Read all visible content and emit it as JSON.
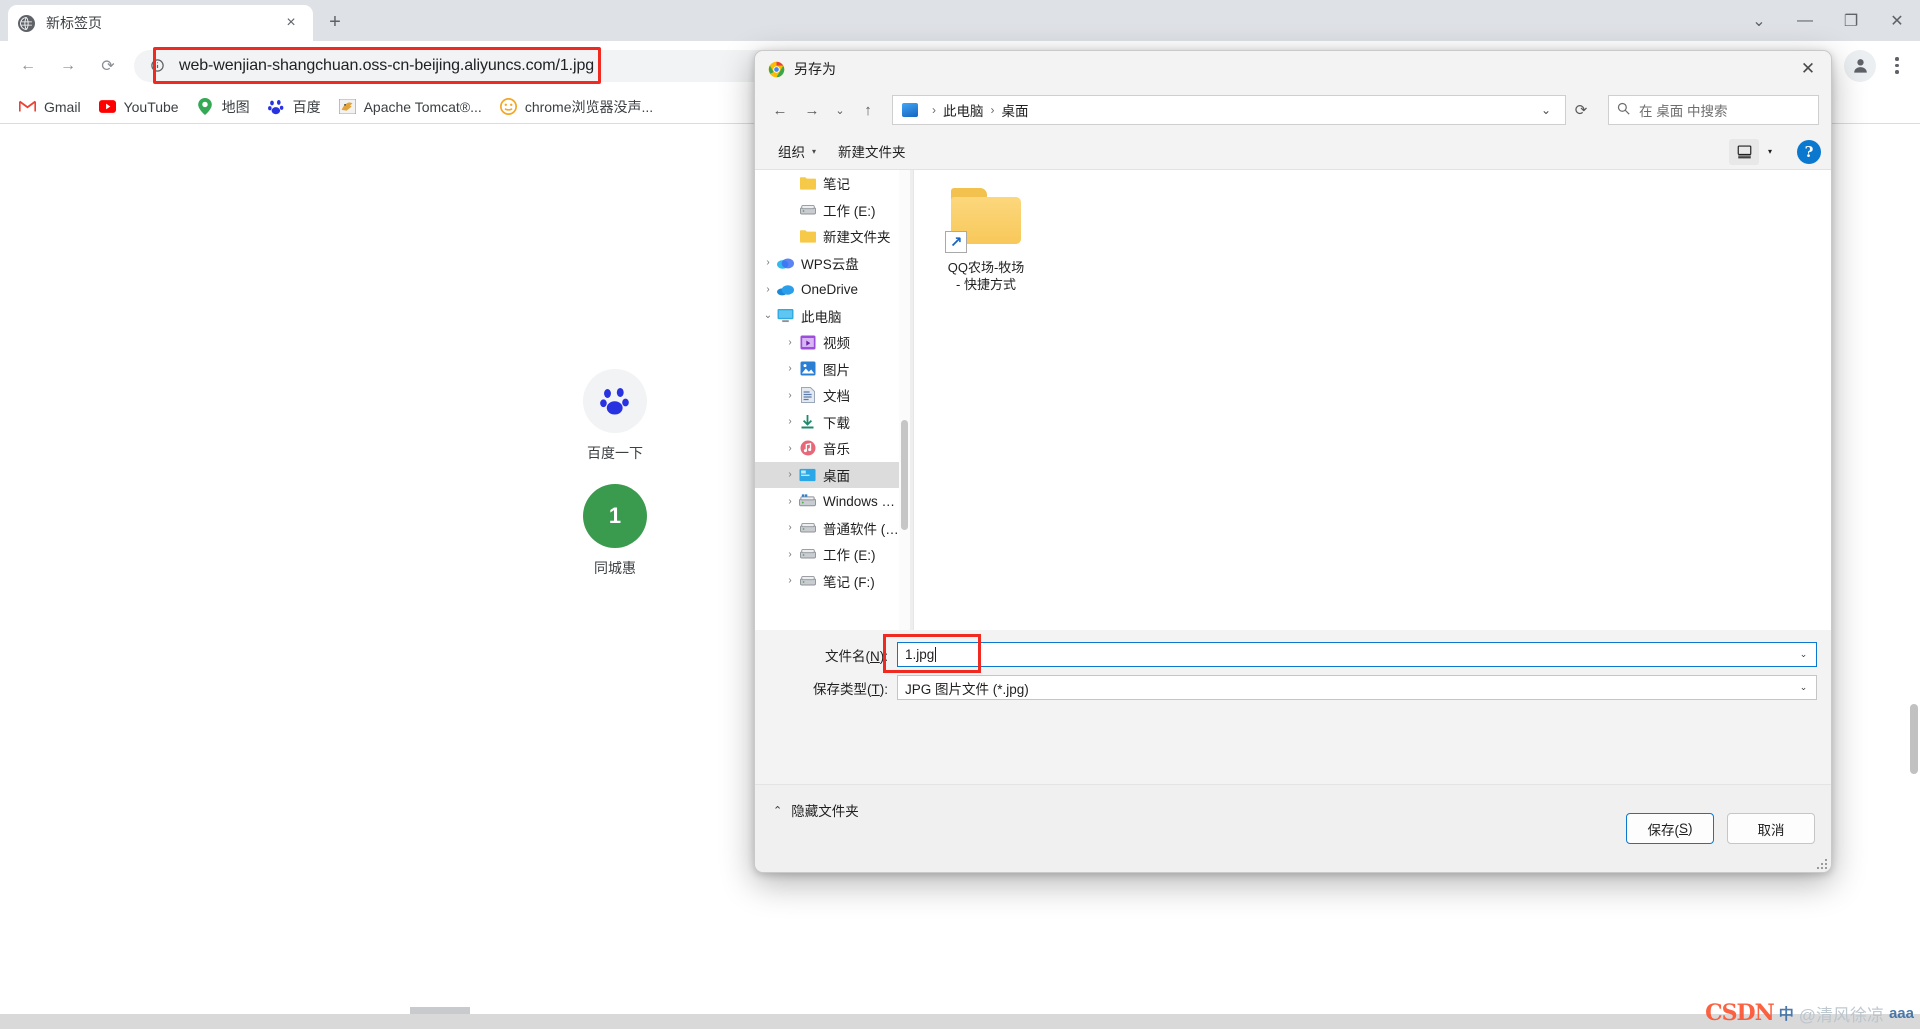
{
  "browser": {
    "tab": {
      "title": "新标签页",
      "favicon": "globe-icon",
      "close": "×"
    },
    "new_tab_label": "+",
    "window_controls": {
      "minimize_group": "⌄",
      "minimize": "—",
      "maximize": "❐",
      "close": "✕"
    },
    "nav": {
      "back": "←",
      "forward": "→",
      "reload": "⟳"
    },
    "omnibox": {
      "url": "web-wenjian-shangchuan.oss-cn-beijing.aliyuncs.com/1.jpg",
      "info_icon": "info-circle-icon",
      "highlight_color": "#f02a21"
    },
    "profile_icon": "account-avatar-icon",
    "menu_icon": "three-dots-menu-icon",
    "bookmarks": [
      {
        "label": "Gmail",
        "icon": "gmail-icon",
        "glyph": "M",
        "color": "#ea4335"
      },
      {
        "label": "YouTube",
        "icon": "youtube-icon",
        "glyph": "▶",
        "color": "#ff0000"
      },
      {
        "label": "地图",
        "icon": "google-maps-icon",
        "glyph": "◉",
        "color": "#34a853"
      },
      {
        "label": "百度",
        "icon": "baidu-icon",
        "glyph": "熊",
        "color": "#2932e1"
      },
      {
        "label": "Apache Tomcat®...",
        "icon": "tomcat-icon",
        "glyph": "🐱",
        "color": "#d1a24a"
      },
      {
        "label": "chrome浏览器没声...",
        "icon": "orange-face-icon",
        "glyph": "☺",
        "color": "#f5a623"
      }
    ]
  },
  "page": {
    "tiles": [
      {
        "label": "百度一下",
        "icon": "baidu-paw-icon",
        "glyph": "熊",
        "bg": "#f1f3f4",
        "fg": "#2932e1"
      },
      {
        "label": "同城惠",
        "icon": "green-number-icon",
        "glyph": "1",
        "bg": "#3a9a4e",
        "fg": "#ffffff"
      }
    ]
  },
  "dialog": {
    "title": "另存为",
    "icon": "chrome-logo-icon",
    "close_label": "✕",
    "nav": {
      "back": "←",
      "forward": "→",
      "recent_chevron": "⌄",
      "up": "↑",
      "address_chevron": "⌄",
      "refresh": "⟳"
    },
    "breadcrumb": {
      "pc_icon": "this-pc-icon",
      "items": [
        "此电脑",
        "桌面"
      ],
      "separator": "›"
    },
    "search": {
      "placeholder": "在 桌面 中搜索",
      "icon": "search-icon"
    },
    "commandbar": {
      "organize": "组织",
      "organize_caret": "▾",
      "new_folder": "新建文件夹",
      "view_icon": "view-layout-icon",
      "view_caret": "▾",
      "help": "?"
    },
    "nav_tree": [
      {
        "label": "笔记",
        "icon": "folder-icon",
        "indent": 1,
        "twisty": "",
        "selected": false
      },
      {
        "label": "工作 (E:)",
        "icon": "drive-icon",
        "indent": 1,
        "twisty": "",
        "selected": false
      },
      {
        "label": "新建文件夹",
        "icon": "folder-icon",
        "indent": 1,
        "twisty": "",
        "selected": false
      },
      {
        "label": "WPS云盘",
        "icon": "wps-cloud-icon",
        "indent": 0,
        "twisty": "›",
        "selected": false
      },
      {
        "label": "OneDrive",
        "icon": "onedrive-icon",
        "indent": 0,
        "twisty": "›",
        "selected": false
      },
      {
        "label": "此电脑",
        "icon": "this-pc-icon",
        "indent": 0,
        "twisty": "⌄",
        "selected": false
      },
      {
        "label": "视频",
        "icon": "videos-icon",
        "indent": 1,
        "twisty": "›",
        "selected": false
      },
      {
        "label": "图片",
        "icon": "pictures-icon",
        "indent": 1,
        "twisty": "›",
        "selected": false
      },
      {
        "label": "文档",
        "icon": "documents-icon",
        "indent": 1,
        "twisty": "›",
        "selected": false
      },
      {
        "label": "下载",
        "icon": "downloads-icon",
        "indent": 1,
        "twisty": "›",
        "selected": false
      },
      {
        "label": "音乐",
        "icon": "music-icon",
        "indent": 1,
        "twisty": "›",
        "selected": false
      },
      {
        "label": "桌面",
        "icon": "desktop-icon",
        "indent": 1,
        "twisty": "›",
        "selected": true
      },
      {
        "label": "Windows (C:)",
        "icon": "windows-drive-icon",
        "indent": 1,
        "twisty": "›",
        "selected": false
      },
      {
        "label": "普通软件 (D:)",
        "icon": "drive-icon",
        "indent": 1,
        "twisty": "›",
        "selected": false
      },
      {
        "label": "工作 (E:)",
        "icon": "drive-icon",
        "indent": 1,
        "twisty": "›",
        "selected": false
      },
      {
        "label": "笔记 (F:)",
        "icon": "drive-icon",
        "indent": 1,
        "twisty": "›",
        "selected": false
      }
    ],
    "files": [
      {
        "name": "QQ农场-牧场 - 快捷方式",
        "icon": "folder-shortcut-icon",
        "shortcut_glyph": "↗"
      }
    ],
    "form": {
      "filename_label_pre": "文件名(",
      "filename_label_key": "N",
      "filename_label_post": "):",
      "filename_value": "1.jpg",
      "savetype_label_pre": "保存类型(",
      "savetype_label_key": "T",
      "savetype_label_post": "):",
      "savetype_value": "JPG 图片文件 (*.jpg)",
      "dropdown_arrow": "⌄",
      "highlight_color": "#f02a21"
    },
    "footer": {
      "hide_folders_chevron": "⌃",
      "hide_folders": "隐藏文件夹",
      "save_pre": "保存(",
      "save_key": "S",
      "save_post": ")",
      "cancel": "取消"
    }
  },
  "watermark": {
    "logo": "CSDN",
    "badge": "中",
    "text": "@清风徐凉",
    "suffix": "aaa"
  }
}
